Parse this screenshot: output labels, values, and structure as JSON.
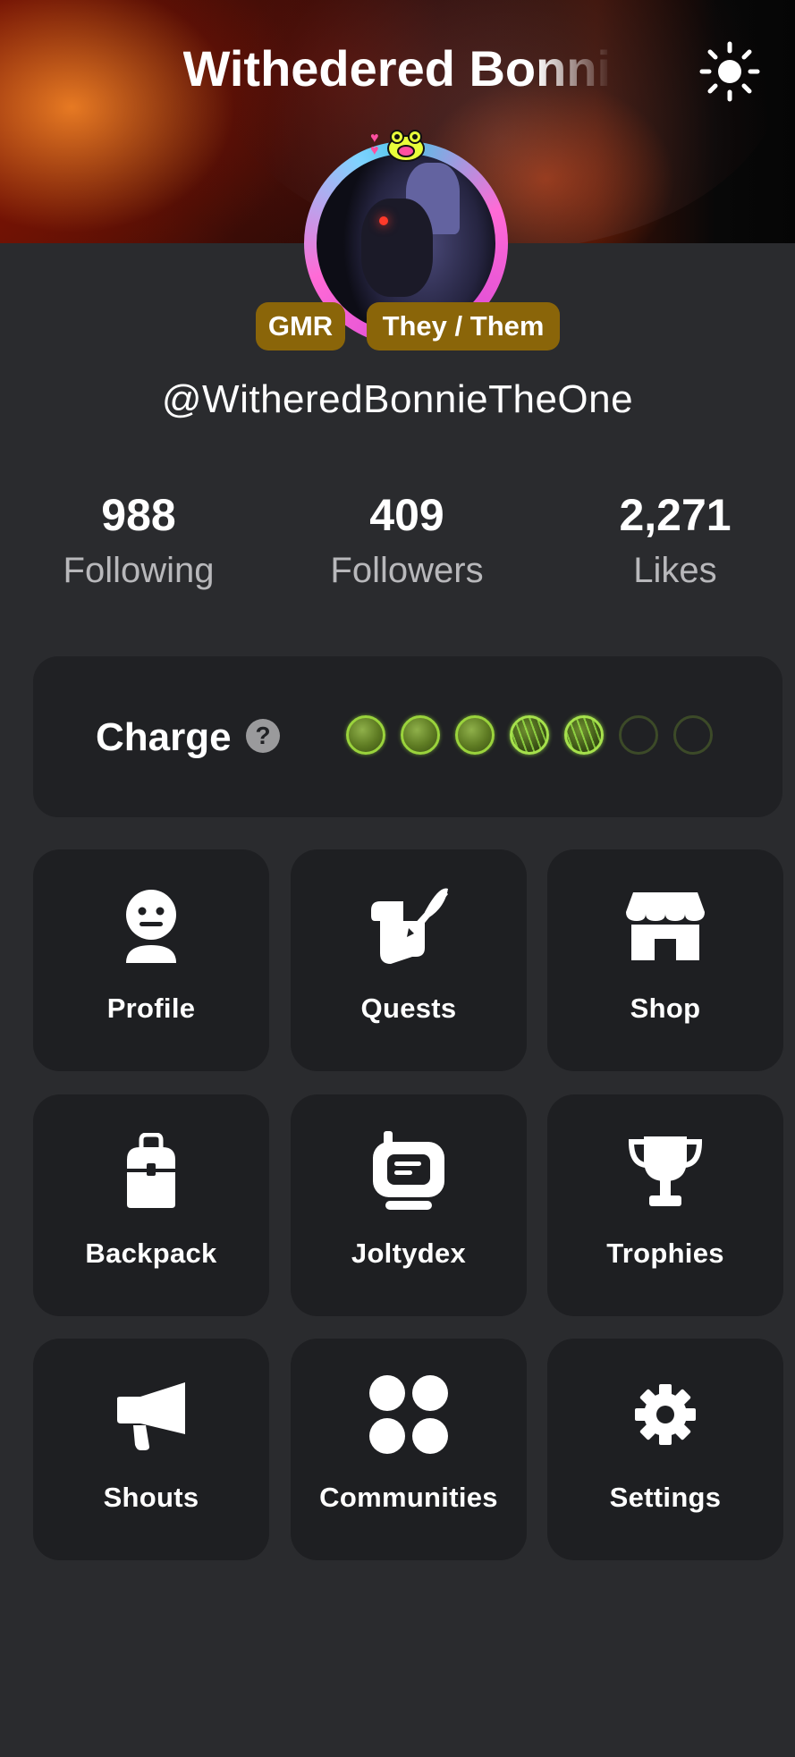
{
  "header": {
    "title": "Withedered Bonnie",
    "theme_icon": "sun-icon"
  },
  "profile": {
    "badges": [
      "GMR",
      "They / Them"
    ],
    "handle": "@WitheredBonnieTheOne"
  },
  "stats": [
    {
      "value": "988",
      "label": "Following"
    },
    {
      "value": "409",
      "label": "Followers"
    },
    {
      "value": "2,271",
      "label": "Likes"
    }
  ],
  "charge": {
    "label": "Charge",
    "help_icon": "question-icon",
    "levels_filled": 3,
    "levels_charging": 2,
    "levels_total": 7,
    "accent_color": "#9ad33c"
  },
  "menu": [
    {
      "label": "Profile",
      "icon": "face-icon"
    },
    {
      "label": "Quests",
      "icon": "quest-scroll-icon"
    },
    {
      "label": "Shop",
      "icon": "storefront-icon"
    },
    {
      "label": "Backpack",
      "icon": "backpack-icon"
    },
    {
      "label": "Joltydex",
      "icon": "joltydex-robot-icon"
    },
    {
      "label": "Trophies",
      "icon": "trophy-icon"
    },
    {
      "label": "Shouts",
      "icon": "megaphone-icon"
    },
    {
      "label": "Communities",
      "icon": "communities-icon"
    },
    {
      "label": "Settings",
      "icon": "gear-icon"
    }
  ],
  "colors": {
    "background": "#2a2b2e",
    "card": "#1e1f22",
    "badge": "#8a6509"
  }
}
